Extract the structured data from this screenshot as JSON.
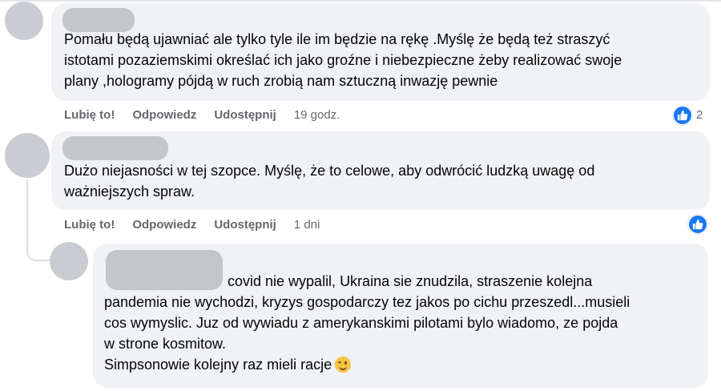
{
  "comments": [
    {
      "text": "Pomału będą ujawniać ale tylko tyle ile im będzie na rękę .Myślę że będą też straszyć istotami pozaziemskimi określać ich jako groźne i niebezpieczne żeby realizować swoje plany ,hologramy pójdą w ruch zrobią nam sztuczną inwazję pewnie",
      "lines": [
        "Pomału będą ujawniać ale tylko tyle ile im będzie na rękę .Myślę że będą też straszyć",
        "istotami pozaziemskimi określać ich jako groźne i niebezpieczne żeby realizować swoje",
        "plany ,hologramy pójdą w ruch zrobią nam sztuczną inwazję pewnie"
      ],
      "actions": {
        "like": "Lubię to!",
        "reply": "Odpowiedz",
        "share": "Udostępnij",
        "time": "19 godz."
      },
      "reaction_count": "2",
      "reaction_icon": "thumbs-up-icon"
    },
    {
      "lines": [
        "Dużo niejasności w tej szopce. Myślę, że to celowe, aby odwrócić ludzką uwagę od",
        "ważniejszych spraw."
      ],
      "actions": {
        "like": "Lubię to!",
        "reply": "Odpowiedz",
        "share": "Udostępnij",
        "time": "1 dni"
      },
      "reaction_icon": "thumbs-up-icon"
    },
    {
      "lines": [
        "covid nie wypalil, Ukraina sie znudzila, straszenie kolejna",
        "pandemia nie wychodzi, kryzys gospodarczy tez jakos po cichu przeszedl...musieli",
        "cos wymyslic. Juz od wywiadu z amerykanskimi pilotami bylo wiadomo, ze pojda",
        "w strone kosmitow.",
        "Simpsonowie kolejny raz mieli racje"
      ],
      "emoji": "winking-face-icon"
    }
  ],
  "colors": {
    "bubble": "#f0f2f5",
    "like_blue": "#1877f2",
    "meta_gray": "#65676b",
    "avatar": "#c9ccd1"
  }
}
